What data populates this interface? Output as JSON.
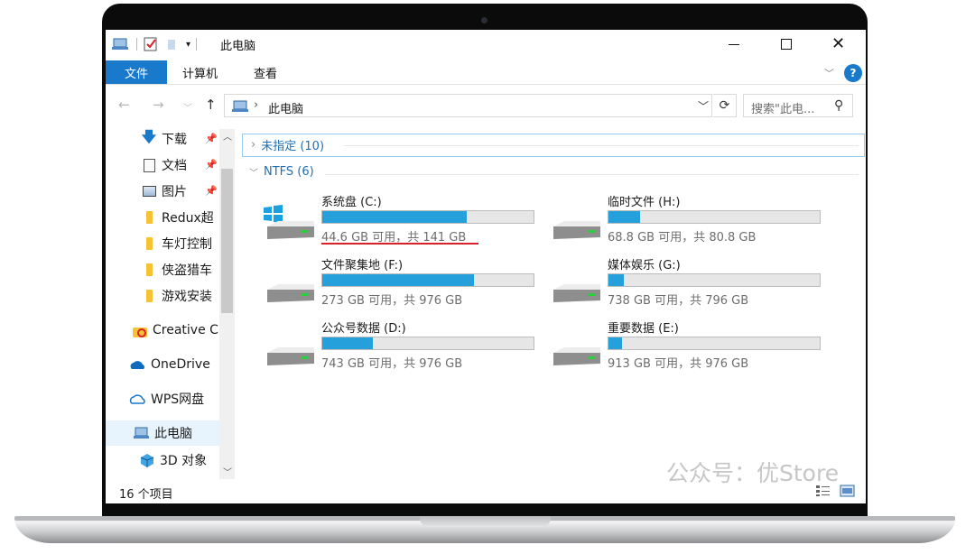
{
  "window": {
    "title": "此电脑",
    "controls": [
      "minimize",
      "maximize",
      "close"
    ]
  },
  "ribbon": {
    "tabs": [
      "文件",
      "计算机",
      "查看"
    ]
  },
  "address": {
    "path": "此电脑",
    "search_placeholder": "搜索\"此电..."
  },
  "sidebar": {
    "items": [
      {
        "label": "下载",
        "icon": "download-icon",
        "pinned": true
      },
      {
        "label": "文档",
        "icon": "document-icon",
        "pinned": true
      },
      {
        "label": "图片",
        "icon": "picture-icon",
        "pinned": true
      },
      {
        "label": "Redux超",
        "icon": "folder-icon"
      },
      {
        "label": "车灯控制",
        "icon": "folder-icon"
      },
      {
        "label": "侠盗猎车",
        "icon": "folder-icon"
      },
      {
        "label": "游戏安装",
        "icon": "folder-icon"
      },
      {
        "label": "Creative C",
        "icon": "creative-cloud-icon"
      },
      {
        "label": "OneDrive",
        "icon": "onedrive-icon"
      },
      {
        "label": "WPS网盘",
        "icon": "cloud-icon"
      },
      {
        "label": "此电脑",
        "icon": "computer-icon",
        "selected": true
      },
      {
        "label": "3D 对象",
        "icon": "3d-objects-icon"
      }
    ]
  },
  "groups": [
    {
      "label": "未指定 (10)",
      "expanded": false
    },
    {
      "label": "NTFS (6)",
      "expanded": true
    }
  ],
  "drives": [
    {
      "name": "系统盘 (C:)",
      "space": "44.6 GB 可用，共 141 GB",
      "used_fraction": 0.684,
      "system": true
    },
    {
      "name": "临时文件 (H:)",
      "space": "68.8 GB 可用，共 80.8 GB",
      "used_fraction": 0.149
    },
    {
      "name": "文件聚集地 (F:)",
      "space": "273 GB 可用，共 976 GB",
      "used_fraction": 0.72
    },
    {
      "name": "媒体娱乐 (G:)",
      "space": "738 GB 可用，共 796 GB",
      "used_fraction": 0.073
    },
    {
      "name": "公众号数据 (D:)",
      "space": "743 GB 可用，共 976 GB",
      "used_fraction": 0.239
    },
    {
      "name": "重要数据 (E:)",
      "space": "913 GB 可用，共 976 GB",
      "used_fraction": 0.065
    }
  ],
  "status": {
    "count": "16 个项目"
  },
  "watermark": "公众号：优Store",
  "colors": {
    "accent": "#1979ca",
    "bar_fill": "#26a0da",
    "highlight_underline": "#d92128"
  }
}
